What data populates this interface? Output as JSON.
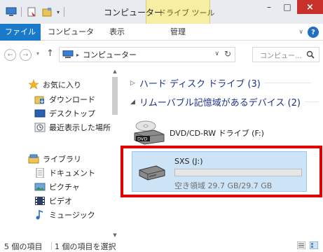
{
  "titlebar": {
    "title": "コンピューター",
    "tool_tab": "ドライブ ツール",
    "minimize": "–",
    "maximize": "□",
    "close": "×"
  },
  "ribbon": {
    "tabs": [
      "ファイル",
      "コンピューター",
      "表示",
      "管理"
    ],
    "help": "?"
  },
  "address": {
    "path": "コンピューター",
    "search_placeholder": "コンピュー..."
  },
  "nav": {
    "favorites": "お気に入り",
    "downloads": "ダウンロード",
    "desktop": "デスクトップ",
    "recent": "最近表示した場所",
    "libraries": "ライブラリ",
    "documents": "ドキュメント",
    "pictures": "ピクチャ",
    "videos": "ビデオ",
    "music": "ミュージック"
  },
  "content": {
    "group_hdd": "ハード ディスク ドライブ (3)",
    "group_removable": "リムーバブル記憶域があるデバイス (2)",
    "dvd_label": "DVD/CD-RW ドライブ (F:)",
    "sxs_name": "SXS (J:)",
    "sxs_free": "空き領域 29.7 GB/29.7 GB",
    "sxs_used_fraction": 0
  },
  "status": {
    "item_count": "5 個の項目",
    "selected": "1 個の項目を選択"
  },
  "colors": {
    "accent": "#1979ca",
    "selection": "#cde4f7",
    "highlight_frame": "#e30000",
    "group_header": "#1e3287"
  }
}
